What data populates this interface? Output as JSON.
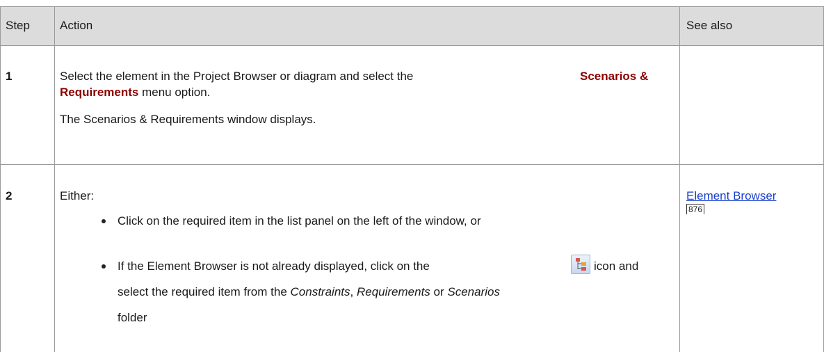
{
  "table": {
    "headers": [
      "Step",
      "Action",
      "See also"
    ],
    "rows": [
      {
        "step": "1",
        "line1_prefix": "Select the element in the Project Browser or diagram and select the",
        "menu_option": "Scenarios & Requirements",
        "line2_suffix": "menu option.",
        "line3": "The Scenarios & Requirements window displays."
      },
      {
        "step": "2",
        "intro": "Either:",
        "bullet1": "Click on the required item in the list panel on the left of the window, or",
        "bullet2_prefix": "If the Element Browser is not already displayed, click on the",
        "bullet2_icon": "element-browser-icon",
        "bullet2_suffix": "icon and",
        "bullet2_line2_prefix": "select the required item from the",
        "folder1": "Constraints",
        "sep1": ",",
        "folder2": "Requirements",
        "sep2": "or",
        "folder3": "Scenarios",
        "bullet2_line3": "folder",
        "see_also_link": "Element Browser",
        "see_also_page": "876"
      }
    ]
  }
}
